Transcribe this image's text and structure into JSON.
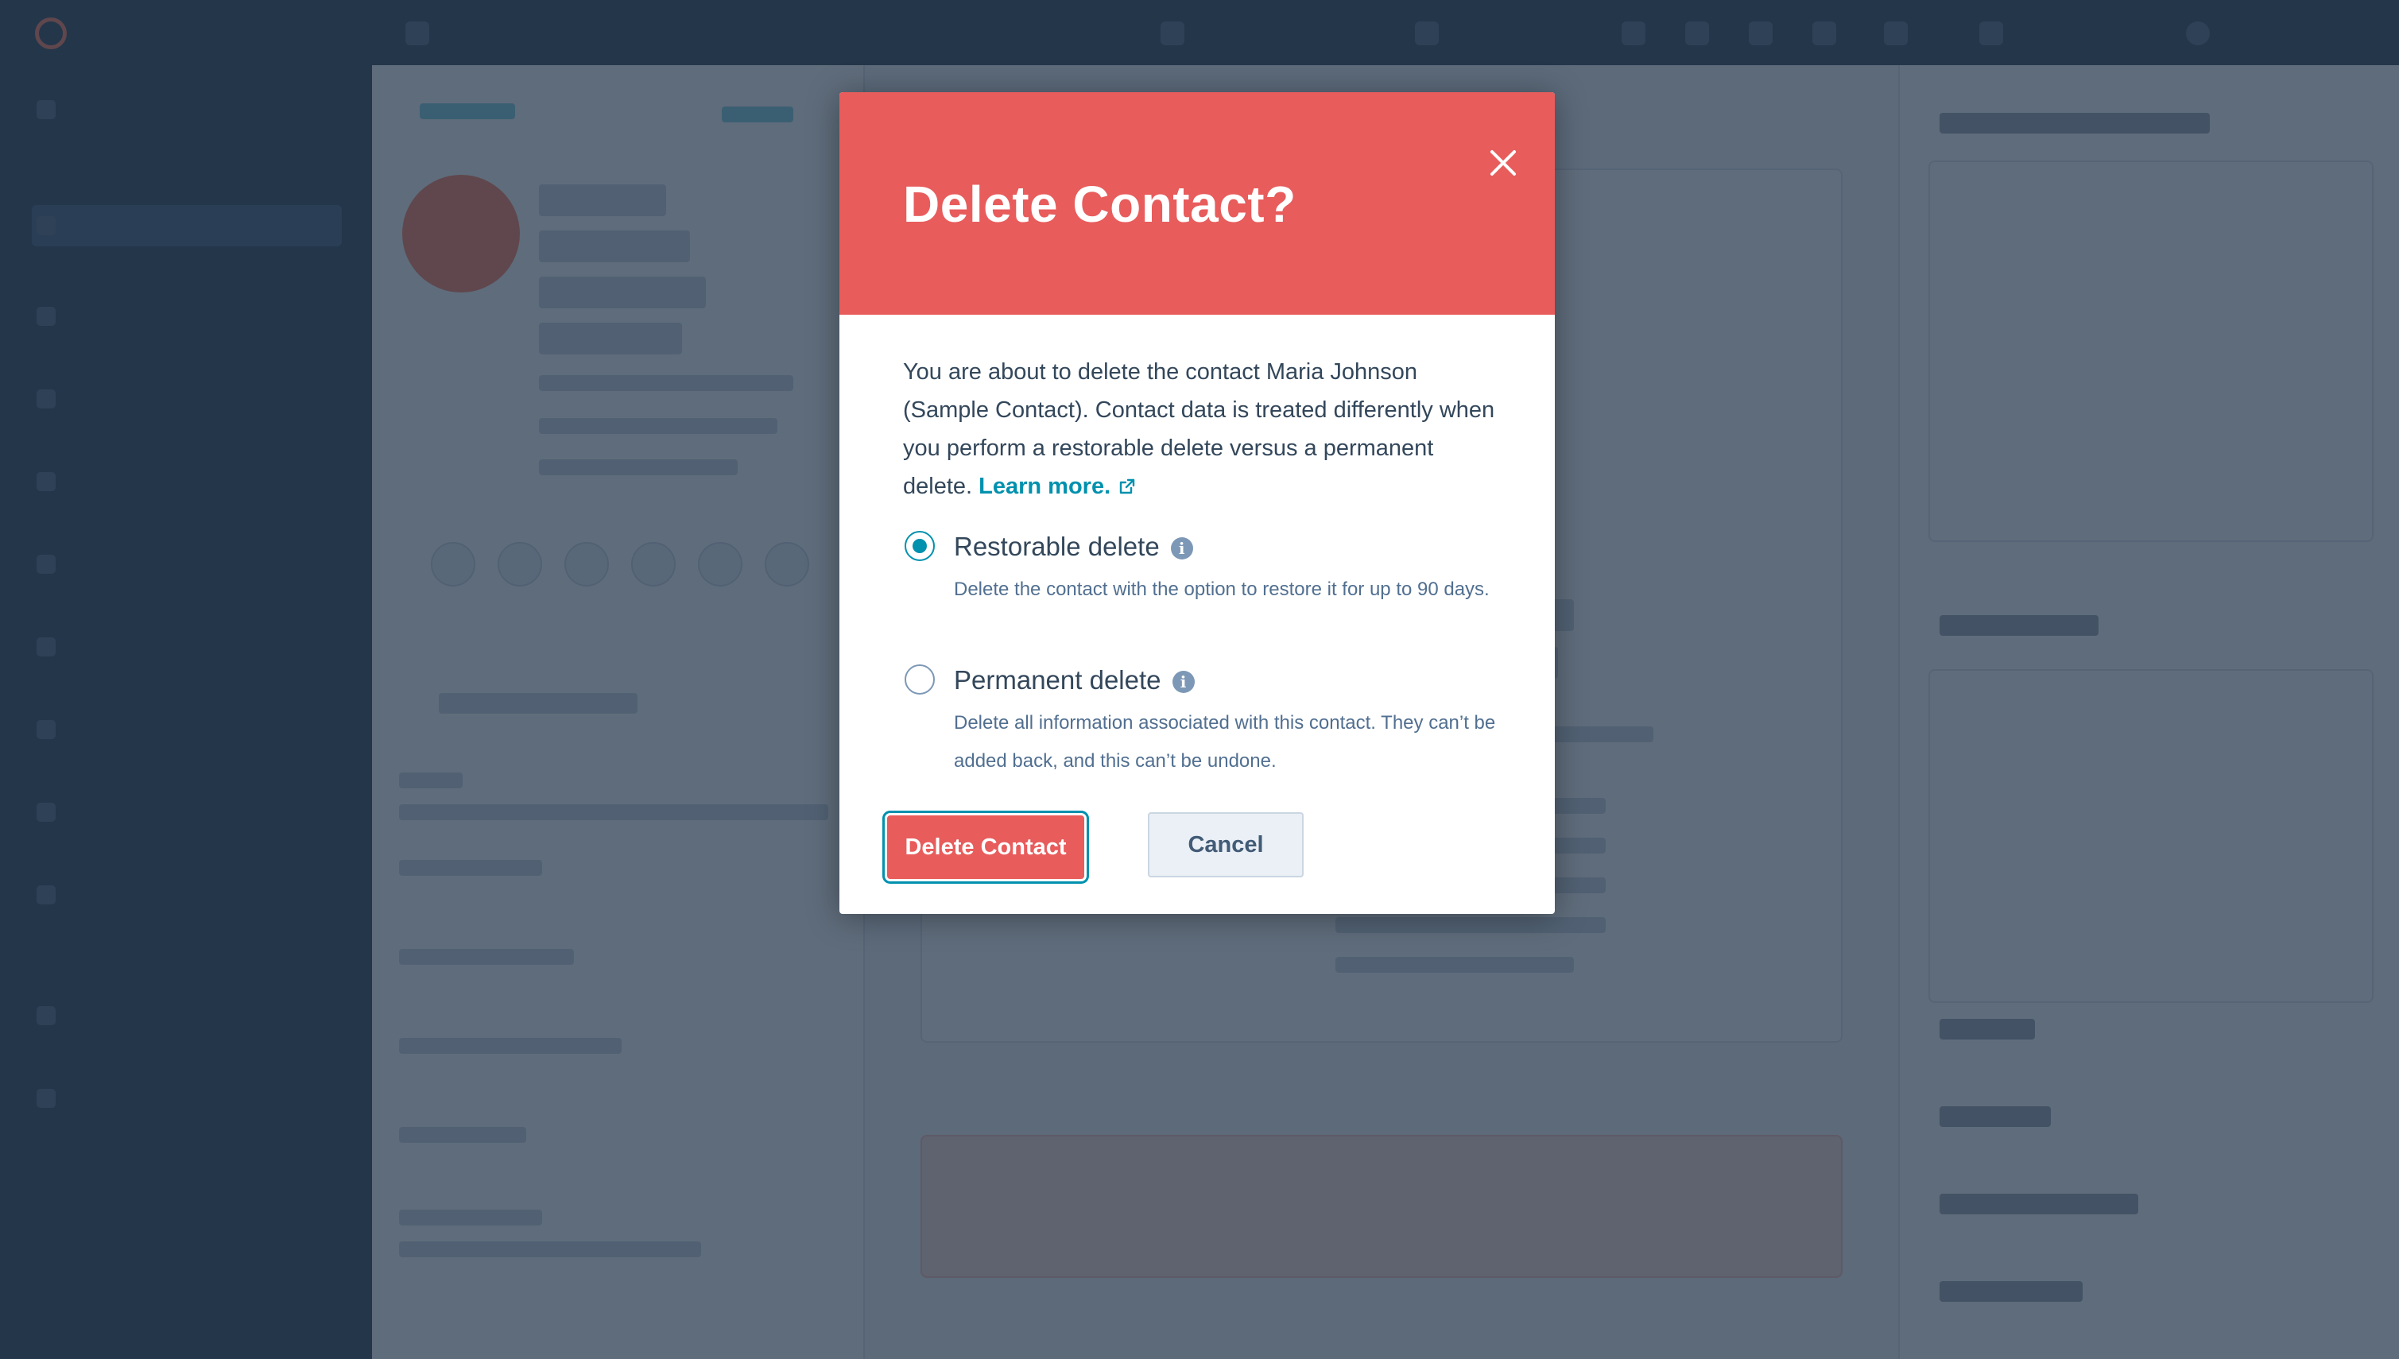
{
  "modal": {
    "title": "Delete Contact?",
    "close_icon": "close-icon",
    "description": "You are about to delete the contact Maria Johnson (Sample Contact). Contact data is treated differently when you perform a restorable delete versus a permanent delete.",
    "learn_more": "Learn more.",
    "learn_more_icon": "external-link-icon",
    "options": [
      {
        "label": "Restorable delete",
        "selected": true,
        "help": "Delete the contact with the option to restore it for up to 90 days."
      },
      {
        "label": "Permanent delete",
        "selected": false,
        "help": "Delete all information associated with this contact. They can’t be added back, and this can’t be undone."
      }
    ],
    "primary_button": "Delete Contact",
    "secondary_button": "Cancel"
  },
  "colors": {
    "header": "#e85c5c",
    "accent": "#0091ae",
    "overlay": "#213348",
    "text": "#33475b"
  }
}
